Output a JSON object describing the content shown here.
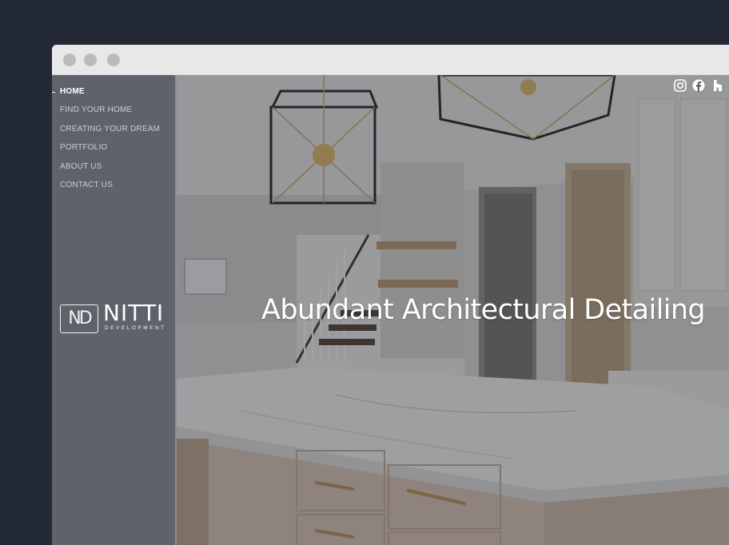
{
  "window": {
    "controls": [
      "close-dot",
      "minimize-dot",
      "maximize-dot"
    ]
  },
  "sidebar": {
    "nav": [
      {
        "label": "HOME",
        "active": true
      },
      {
        "label": "FIND YOUR HOME",
        "active": false
      },
      {
        "label": "CREATING YOUR DREAM",
        "active": false
      },
      {
        "label": "PORTFOLIO",
        "active": false
      },
      {
        "label": "ABOUT US",
        "active": false
      },
      {
        "label": "CONTACT US",
        "active": false
      }
    ],
    "logo": {
      "monogram": "ND",
      "name": "NITTI",
      "sub": "DEVELOPMENT"
    }
  },
  "hero": {
    "headline": "Abundant Architectural Detailing"
  },
  "social": {
    "icons": [
      "instagram-icon",
      "facebook-icon",
      "houzz-icon"
    ]
  },
  "colors": {
    "page_bg": "#232a35",
    "sidebar_bg": "#5e636b",
    "titlebar_bg": "#e8e8e8",
    "nav_text": "#c9ccd0",
    "nav_active": "#ffffff"
  }
}
